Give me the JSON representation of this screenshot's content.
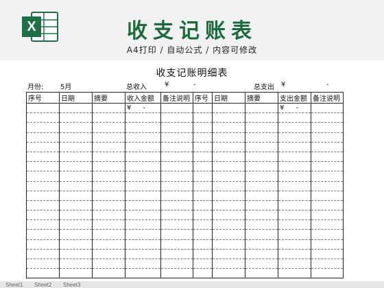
{
  "banner": {
    "title": "收支记账表",
    "subtitle": "A4打印 / 自动公式 / 内容可修改",
    "logo_icon": "excel-icon",
    "brand_color": "#1a6b3c"
  },
  "sheet": {
    "title": "收支记账明细表",
    "month_label": "月份:",
    "month_value": "5月",
    "income_total_label": "总收入",
    "income_total_currency": "¥",
    "income_total_value": "-",
    "expense_total_label": "总支出",
    "expense_total_currency": "¥",
    "expense_total_value": "-"
  },
  "income_table": {
    "headers": [
      "序号",
      "日期",
      "摘要",
      "收入金额",
      "备注说明"
    ],
    "sum_currency": "¥",
    "sum_value": "-"
  },
  "expense_table": {
    "headers": [
      "序号",
      "日期",
      "摘要",
      "支出金额",
      "备注说明"
    ],
    "sum_currency": "¥",
    "sum_value": "-"
  },
  "tabs": [
    "Sheet1",
    "Sheet2",
    "Sheet3"
  ]
}
